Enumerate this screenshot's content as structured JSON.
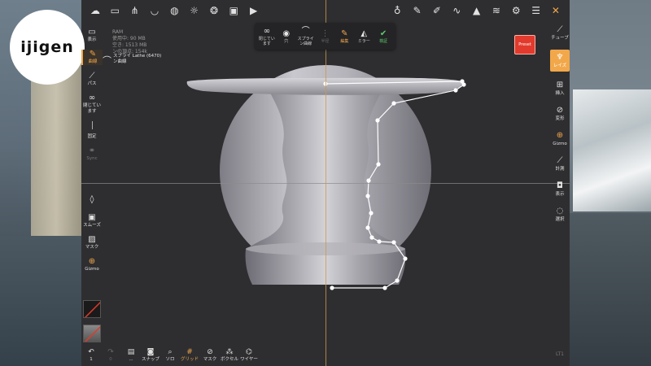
{
  "logo": {
    "text": "ijigen"
  },
  "top_toolbar": {
    "icons": [
      "cloud-icon",
      "folder-icon",
      "share-icon",
      "cup-icon",
      "globe-icon",
      "sun-icon",
      "aperture-icon",
      "image-icon",
      "video-icon",
      "lamp-icon",
      "brush-icon",
      "pen-icon",
      "stroke-icon",
      "cone-icon",
      "layers-icon",
      "gear-icon",
      "sliders-icon",
      "tools-icon"
    ]
  },
  "stats": {
    "ram": "RAM",
    "used": "使用中: 90 MB",
    "free": "空き: 1513 MB",
    "vertices": "ンの頂点: 154k"
  },
  "spline_panel": {
    "items": [
      {
        "label": "閉じてい\nます",
        "icon": "∞",
        "state": "normal"
      },
      {
        "label": "穴",
        "icon": "◉",
        "state": "normal"
      },
      {
        "label": "スプライ\nン曲線",
        "icon": "⌒",
        "state": "normal"
      },
      {
        "label": "半径",
        "icon": "⋮",
        "state": "dim"
      },
      {
        "label": "編集",
        "icon": "✎",
        "state": "orange"
      },
      {
        "label": "ミラー",
        "icon": "◭",
        "state": "normal"
      },
      {
        "label": "検証",
        "icon": "✔",
        "state": "green"
      }
    ]
  },
  "preset_button": {
    "label": "Preset"
  },
  "left_panel": {
    "display": "表示",
    "curve": "曲線",
    "path": "パス",
    "closed": "閉じてい\nます",
    "fixed": "固定",
    "sync": "Sync"
  },
  "spline_tag": {
    "label": "スプライ Lathe (6470)\nン曲線"
  },
  "lower_left": {
    "smooth": "スムーズ",
    "mask": "マスク",
    "gizmo": "Gizmo"
  },
  "right_panel": {
    "curve": "チューブ",
    "lathe": "レイズ",
    "insert": "挿入",
    "transform": "変形",
    "gizmo": "Gizmo",
    "measure": "計測",
    "view": "表示",
    "select": "選択"
  },
  "bottom_toolbar": {
    "undo": "1",
    "redo": "0",
    "stack": "...",
    "snap": "スナップ",
    "solo": "ソロ",
    "grid": "グリッド",
    "mask": "マスク",
    "voxel": "ボクセル",
    "wire": "ワイヤー"
  },
  "corner_label": "LT1",
  "colors": {
    "accent": "#f0a64a",
    "viewport": "#2e2e30",
    "model": "#9b9aa2",
    "validate": "#5fcb6a",
    "preset": "#e23a2c"
  }
}
